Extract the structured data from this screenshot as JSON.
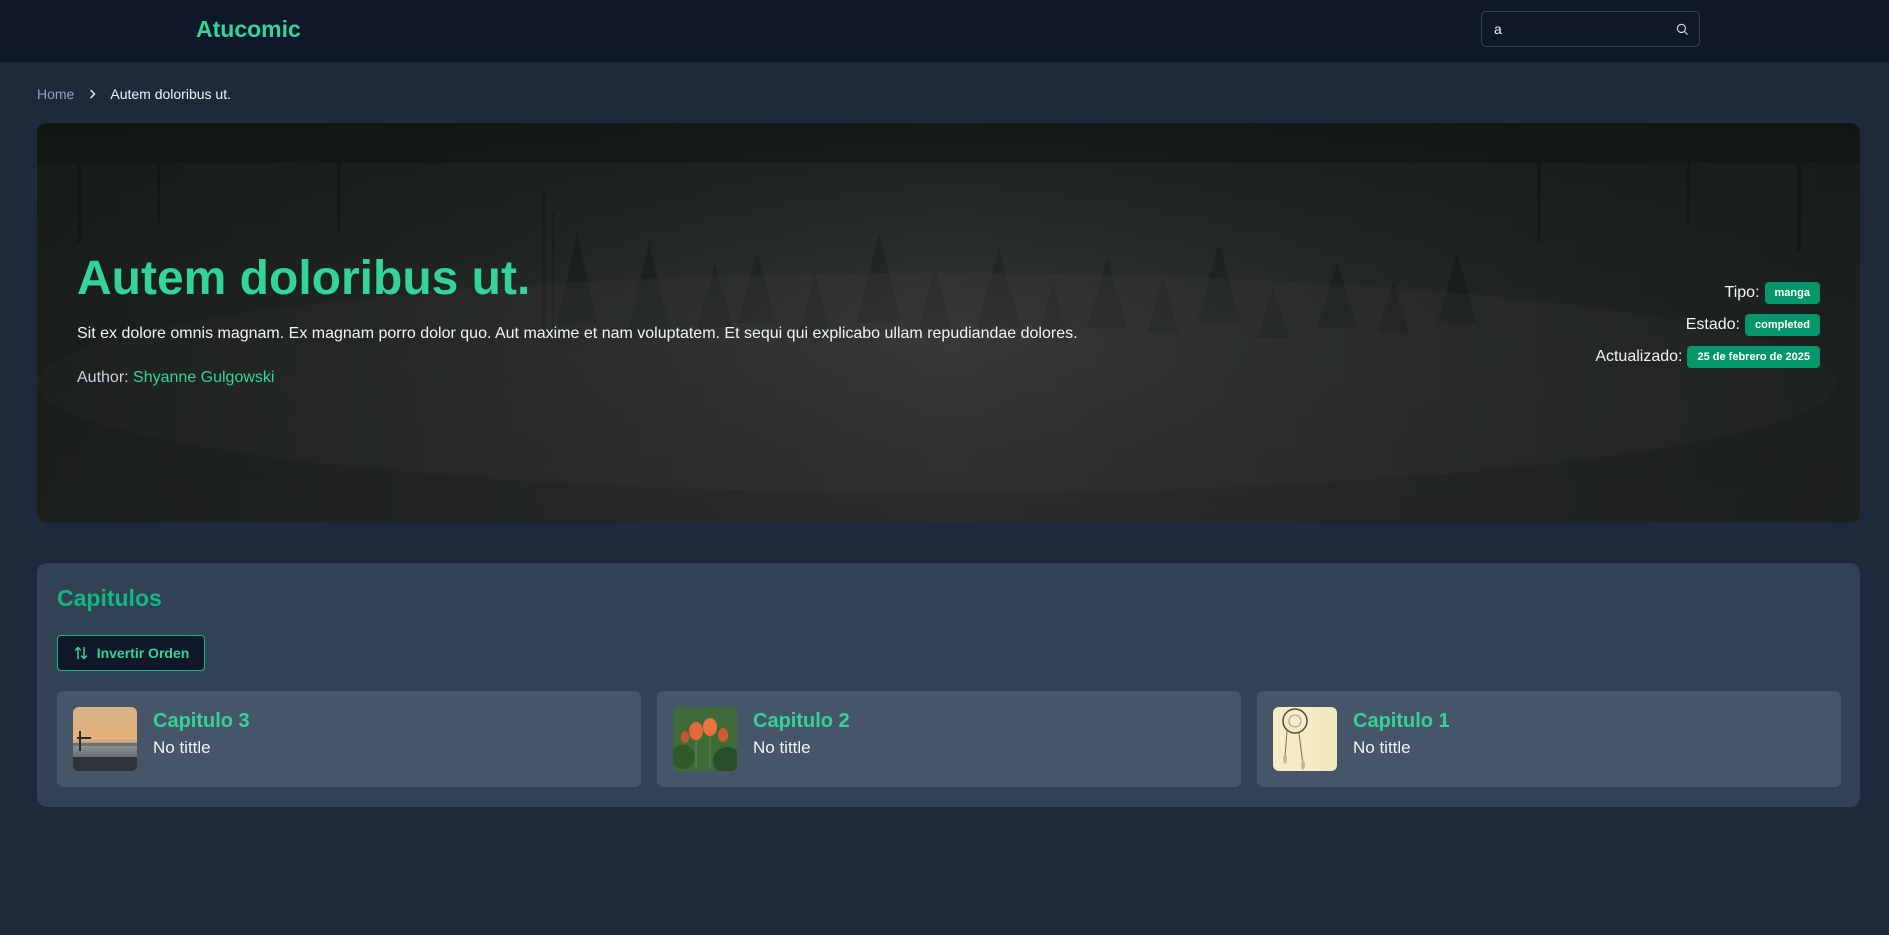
{
  "navbar": {
    "brand": "Atucomic",
    "search": {
      "value": "a",
      "icon": "search-icon"
    }
  },
  "breadcrumb": {
    "home": "Home",
    "current": "Autem doloribus ut.",
    "separator_icon": "chevron-right-icon"
  },
  "comic": {
    "title": "Autem doloribus ut.",
    "description": "Sit ex dolore omnis magnam. Ex magnam porro dolor quo. Aut maxime et nam voluptatem. Et sequi qui explicabo ullam repudiandae dolores.",
    "author_label": "Author:",
    "author": "Shyanne Gulgowski",
    "meta": {
      "tipo_label": "Tipo:",
      "tipo": "manga",
      "estado_label": "Estado:",
      "estado": "completed",
      "actualizado_label": "Actualizado:",
      "actualizado": "25 de febrero de 2025"
    }
  },
  "chapters": {
    "heading": "Capitulos",
    "sort_button": "Invertir Orden",
    "sort_icon": "sort-arrows-icon",
    "items": [
      {
        "title": "Capitulo 3",
        "subtitle": "No tittle"
      },
      {
        "title": "Capitulo 2",
        "subtitle": "No tittle"
      },
      {
        "title": "Capitulo 1",
        "subtitle": "No tittle"
      }
    ]
  },
  "colors": {
    "accent": "#34d399",
    "badge": "#059669",
    "navbar": "#0f172a",
    "page_bg": "#1e293b",
    "panel": "#334155",
    "card": "#475569"
  }
}
